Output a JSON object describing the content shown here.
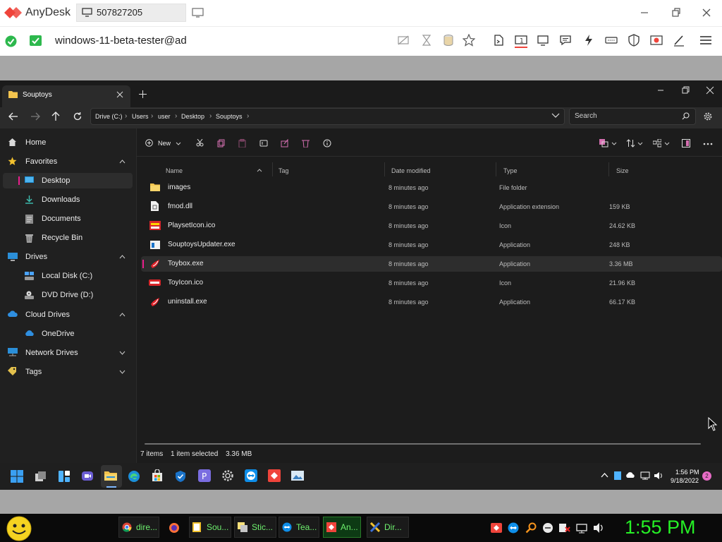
{
  "anydesk": {
    "app_name": "AnyDesk",
    "session_id": "507827205",
    "address": "windows-11-beta-tester@ad",
    "brand_color": "#ef443b"
  },
  "files": {
    "tab_title": "Souptoys",
    "breadcrumbs": [
      "Drive (C:)",
      "Users",
      "user",
      "Desktop",
      "Souptoys"
    ],
    "search_placeholder": "Search",
    "new_label": "New",
    "sidebar": {
      "home": "Home",
      "favorites": "Favorites",
      "desktop": "Desktop",
      "downloads": "Downloads",
      "documents": "Documents",
      "recycle_bin": "Recycle Bin",
      "drives": "Drives",
      "local_disk": "Local Disk (C:)",
      "dvd_drive": "DVD Drive (D:)",
      "cloud_drives": "Cloud Drives",
      "onedrive": "OneDrive",
      "network_drives": "Network Drives",
      "tags": "Tags"
    },
    "columns": {
      "name": "Name",
      "tag": "Tag",
      "date_modified": "Date modified",
      "type": "Type",
      "size": "Size"
    },
    "rows": [
      {
        "name": "images",
        "date": "8 minutes ago",
        "type": "File folder",
        "size": ""
      },
      {
        "name": "fmod.dll",
        "date": "8 minutes ago",
        "type": "Application extension",
        "size": "159 KB"
      },
      {
        "name": "PlaysetIcon.ico",
        "date": "8 minutes ago",
        "type": "Icon",
        "size": "24.62 KB"
      },
      {
        "name": "SouptoysUpdater.exe",
        "date": "8 minutes ago",
        "type": "Application",
        "size": "248 KB"
      },
      {
        "name": "Toybox.exe",
        "date": "8 minutes ago",
        "type": "Application",
        "size": "3.36 MB"
      },
      {
        "name": "ToyIcon.ico",
        "date": "8 minutes ago",
        "type": "Icon",
        "size": "21.96 KB"
      },
      {
        "name": "uninstall.exe",
        "date": "8 minutes ago",
        "type": "Application",
        "size": "66.17 KB"
      }
    ],
    "status": {
      "items": "7 items",
      "selected": "1 item selected",
      "size": "3.36 MB"
    },
    "accent_color": "#e91e8c"
  },
  "win11_taskbar": {
    "time": "1:56 PM",
    "date": "9/18/2022",
    "notifications": "2"
  },
  "local_taskbar": {
    "tasks": [
      "dire...",
      "Sou...",
      "Stic...",
      "Tea...",
      "An...",
      "Dir..."
    ],
    "clock": "1:55 PM"
  }
}
